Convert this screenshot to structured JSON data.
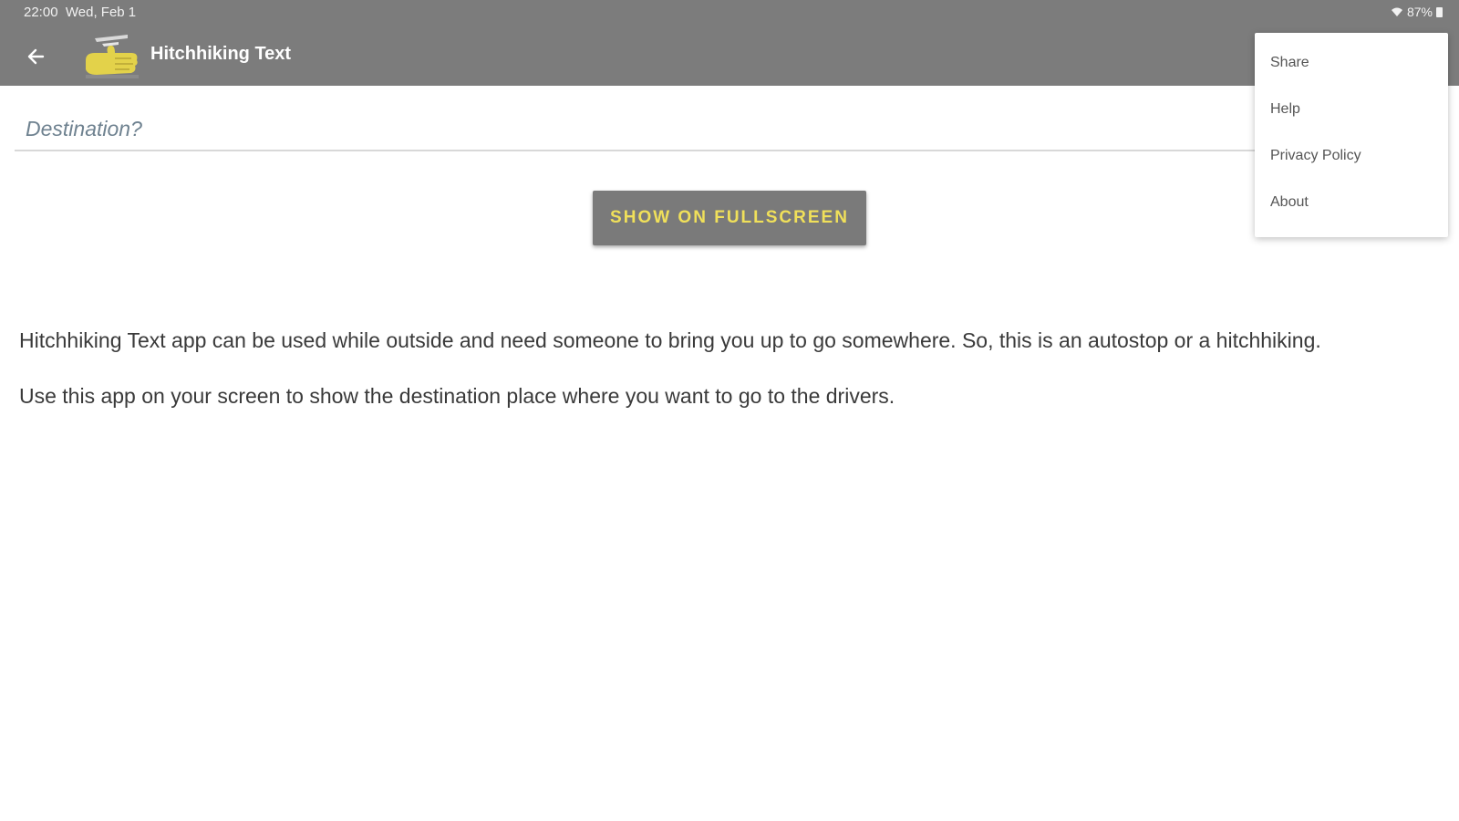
{
  "status_bar": {
    "time": "22:00",
    "date": "Wed, Feb 1",
    "battery": "87%",
    "icons": [
      "wifi-icon",
      "battery-icon"
    ]
  },
  "app_bar": {
    "title": "Hitchhiking Text",
    "back_icon": "arrow-left-icon",
    "logo": "hitchhiking-thumb-logo"
  },
  "destination": {
    "value": "",
    "placeholder": "Destination?"
  },
  "fullscreen_button": {
    "label": "SHOW ON FULLSCREEN"
  },
  "description": {
    "paragraph1": "Hitchhiking Text app can be used while outside and need someone to bring you up to go somewhere. So, this is an autostop or a hitchhiking.",
    "paragraph2": "Use this app on your screen to show the destination place where you want to go to the drivers."
  },
  "menu": {
    "items": [
      {
        "label": "Share"
      },
      {
        "label": "Help"
      },
      {
        "label": "Privacy Policy"
      },
      {
        "label": "About"
      }
    ]
  },
  "colors": {
    "app_bar": "#7c7c7c",
    "button_background": "#7a7a7a",
    "button_text": "#f0e05a",
    "placeholder": "#6f8290"
  }
}
